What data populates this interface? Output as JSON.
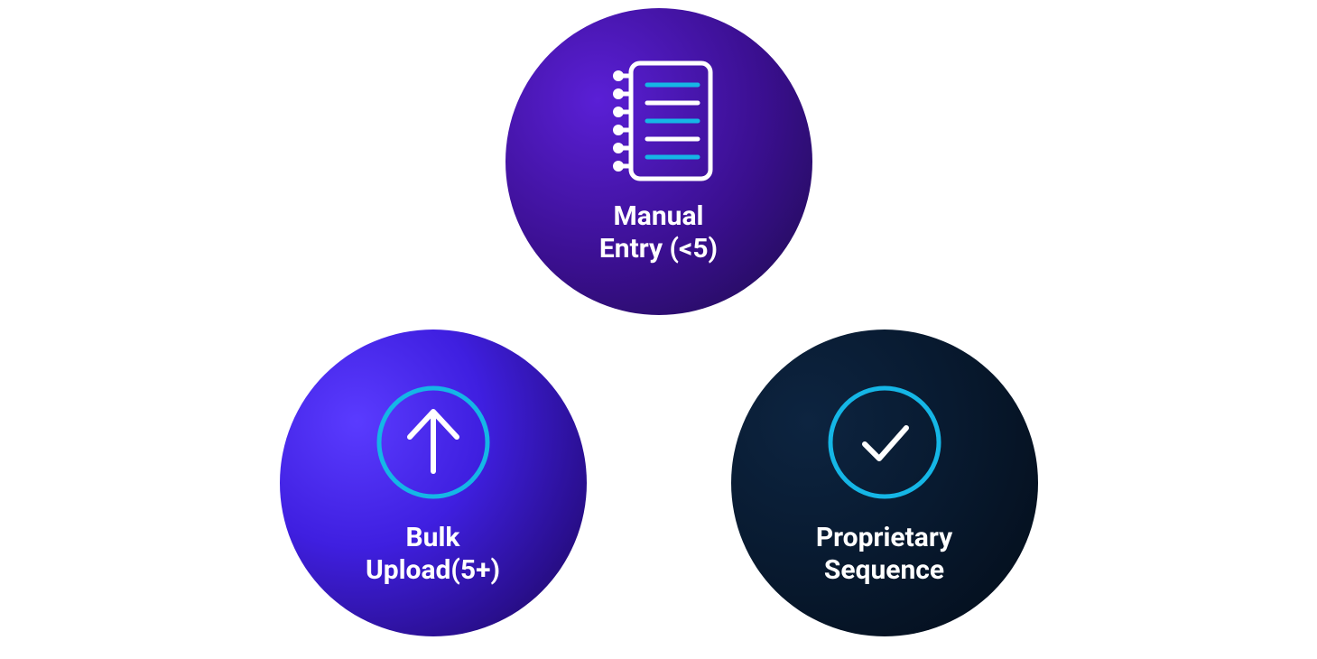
{
  "options": {
    "manual": {
      "label": "Manual\nEntry (<5)",
      "icon": "notebook-icon"
    },
    "bulk": {
      "label": "Bulk\nUpload(5+)",
      "icon": "upload-circle-icon"
    },
    "proprietary": {
      "label": "Proprietary\nSequence",
      "icon": "checkmark-circle-icon"
    }
  },
  "colors": {
    "accent_cyan": "#15b6e6",
    "stroke_white": "#ffffff"
  }
}
